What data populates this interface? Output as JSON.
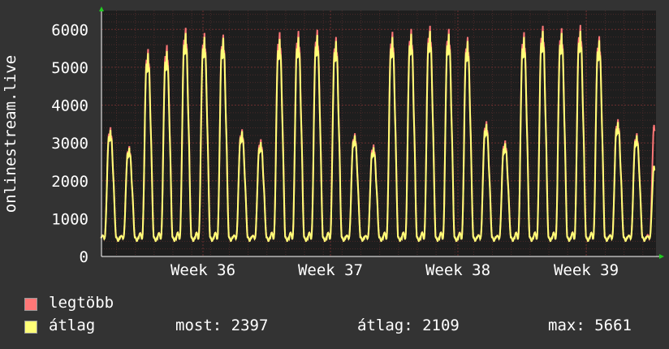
{
  "chart_data": {
    "type": "line",
    "ylabel": "onlinestream.live",
    "yticks": [
      0,
      1000,
      2000,
      3000,
      4000,
      5000,
      6000
    ],
    "ylim": [
      0,
      6500
    ],
    "xticks": [
      "Week 36",
      "Week 37",
      "Week 38",
      "Week 39"
    ],
    "grid": true,
    "series": [
      {
        "name": "legtöbb",
        "color": "#ff7777"
      },
      {
        "name": "átlag",
        "color": "#ffff77"
      }
    ],
    "day_peaks": {
      "legtobb": [
        3250,
        2780,
        5200,
        5300,
        5730,
        5600,
        5560,
        3200,
        2950,
        5620,
        5650,
        5680,
        5500,
        3100,
        2820,
        5630,
        5700,
        5780,
        5700,
        5500,
        3400,
        2920,
        5620,
        5780,
        5720,
        5800,
        5520,
        3450,
        3100
      ],
      "atlag": [
        3180,
        2740,
        5100,
        5150,
        5600,
        5500,
        5480,
        3150,
        2880,
        5450,
        5500,
        5550,
        5400,
        3050,
        2750,
        5500,
        5580,
        5650,
        5580,
        5400,
        3330,
        2850,
        5500,
        5650,
        5600,
        5650,
        5420,
        3380,
        3050
      ]
    },
    "trailing_legtobb": 3480,
    "trailing_atlag": 2397,
    "baseline": 480
  },
  "legend": {
    "max_label": "legtöbb",
    "avg_label": "átlag",
    "now": "most: 2397",
    "avg": "átlag: 2109",
    "max": "max: 5661"
  }
}
